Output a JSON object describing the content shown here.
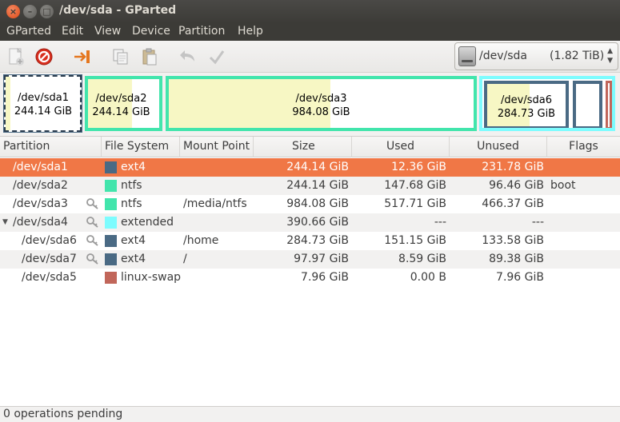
{
  "window": {
    "title": "/dev/sda - GParted"
  },
  "menu": [
    "GParted",
    "Edit",
    "View",
    "Device",
    "Partition",
    "Help"
  ],
  "toolbar": {
    "icons": [
      "new-partition-icon",
      "delete-icon",
      "resize-move-icon",
      "copy-icon",
      "paste-icon",
      "undo-icon",
      "apply-icon"
    ]
  },
  "device": {
    "name": "/dev/sda",
    "size": "(1.82 TiB)"
  },
  "map": {
    "partitions": [
      {
        "name": "/dev/sda1",
        "size": "244.14 GiB",
        "fs": "ext4",
        "used_fraction": 0.05
      },
      {
        "name": "/dev/sda2",
        "size": "244.14 GiB",
        "fs": "ntfs",
        "used_fraction": 0.6
      },
      {
        "name": "/dev/sda3",
        "size": "984.08 GiB",
        "fs": "ntfs",
        "used_fraction": 0.53
      },
      {
        "name": "/dev/sda6",
        "size": "284.73 GiB",
        "fs": "ext4",
        "used_fraction": 0.53
      }
    ]
  },
  "table": {
    "columns": [
      "Partition",
      "File System",
      "Mount Point",
      "Size",
      "Used",
      "Unused",
      "Flags"
    ],
    "rows": [
      {
        "partition": "/dev/sda1",
        "fs": "ext4",
        "fs_color": "#4a6a84",
        "mount": "",
        "size": "244.14 GiB",
        "used": "12.36 GiB",
        "unused": "231.78 GiB",
        "flags": "",
        "key": false,
        "selected": true
      },
      {
        "partition": "/dev/sda2",
        "fs": "ntfs",
        "fs_color": "#42e5ac",
        "mount": "",
        "size": "244.14 GiB",
        "used": "147.68 GiB",
        "unused": "96.46 GiB",
        "flags": "boot",
        "key": false,
        "selected": false
      },
      {
        "partition": "/dev/sda3",
        "fs": "ntfs",
        "fs_color": "#42e5ac",
        "mount": "/media/ntfs",
        "size": "984.08 GiB",
        "used": "517.71 GiB",
        "unused": "466.37 GiB",
        "flags": "",
        "key": true,
        "selected": false
      },
      {
        "partition": "/dev/sda4",
        "fs": "extended",
        "fs_color": "#7dfcfe",
        "mount": "",
        "size": "390.66 GiB",
        "used": "---",
        "unused": "---",
        "flags": "",
        "key": true,
        "selected": false
      },
      {
        "partition": "/dev/sda6",
        "fs": "ext4",
        "fs_color": "#4a6a84",
        "mount": "/home",
        "size": "284.73 GiB",
        "used": "151.15 GiB",
        "unused": "133.58 GiB",
        "flags": "",
        "key": true,
        "selected": false
      },
      {
        "partition": "/dev/sda7",
        "fs": "ext4",
        "fs_color": "#4a6a84",
        "mount": "/",
        "size": "97.97 GiB",
        "used": "8.59 GiB",
        "unused": "89.38 GiB",
        "flags": "",
        "key": true,
        "selected": false
      },
      {
        "partition": "/dev/sda5",
        "fs": "linux-swap",
        "fs_color": "#c1665a",
        "mount": "",
        "size": "7.96 GiB",
        "used": "0.00 B",
        "unused": "7.96 GiB",
        "flags": "",
        "key": false,
        "selected": false
      }
    ]
  },
  "status": {
    "text": "0 operations pending"
  }
}
